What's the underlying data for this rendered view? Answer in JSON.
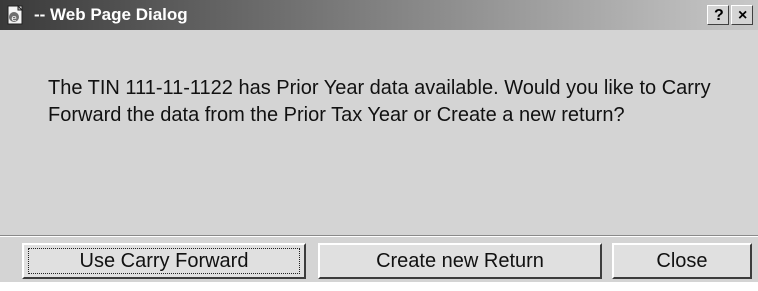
{
  "window": {
    "title": "-- Web Page Dialog",
    "help_label": "?",
    "close_label": "×"
  },
  "message": {
    "text": "The TIN 111-11-1122 has Prior Year data available. Would you like to Carry Forward the data from the Prior Tax Year or Create a new return?"
  },
  "buttons": {
    "carry_forward": "Use Carry Forward",
    "create_new": "Create new Return",
    "close": "Close"
  },
  "icons": {
    "app": "ie-page-icon",
    "help": "help-icon",
    "close": "close-icon"
  },
  "colors": {
    "dialog_bg": "#d4d4d4",
    "titlebar_start": "#3a3a3a",
    "titlebar_end": "#c8c8c8",
    "title_text": "#ffffff"
  }
}
